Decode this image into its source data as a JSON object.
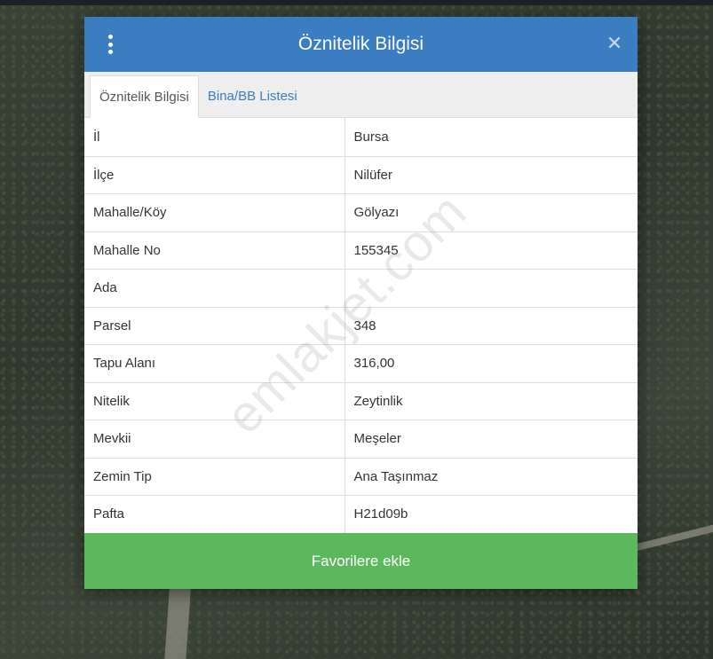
{
  "modal": {
    "title": "Öznitelik Bilgisi",
    "close_label": "✕",
    "tabs": [
      {
        "label": "Öznitelik Bilgisi",
        "active": true
      },
      {
        "label": "Bina/BB Listesi",
        "active": false
      }
    ],
    "rows": [
      {
        "key": "İl",
        "value": "Bursa"
      },
      {
        "key": "İlçe",
        "value": "Nilüfer"
      },
      {
        "key": "Mahalle/Köy",
        "value": "Gölyazı"
      },
      {
        "key": "Mahalle No",
        "value": "155345"
      },
      {
        "key": "Ada",
        "value": ""
      },
      {
        "key": "Parsel",
        "value": "348"
      },
      {
        "key": "Tapu Alanı",
        "value": "316,00"
      },
      {
        "key": "Nitelik",
        "value": "Zeytinlik"
      },
      {
        "key": "Mevkii",
        "value": "Meşeler"
      },
      {
        "key": "Zemin Tip",
        "value": "Ana Taşınmaz"
      },
      {
        "key": "Pafta",
        "value": "H21d09b"
      }
    ],
    "favorite_button": "Favorilere ekle"
  },
  "watermark": "emlakjet.com",
  "icons": {
    "menu": "kebab-menu-icon",
    "close": "close-icon"
  },
  "colors": {
    "header": "#3a7dc0",
    "tab_link": "#3a7dc0",
    "favorite": "#5cb85c"
  }
}
